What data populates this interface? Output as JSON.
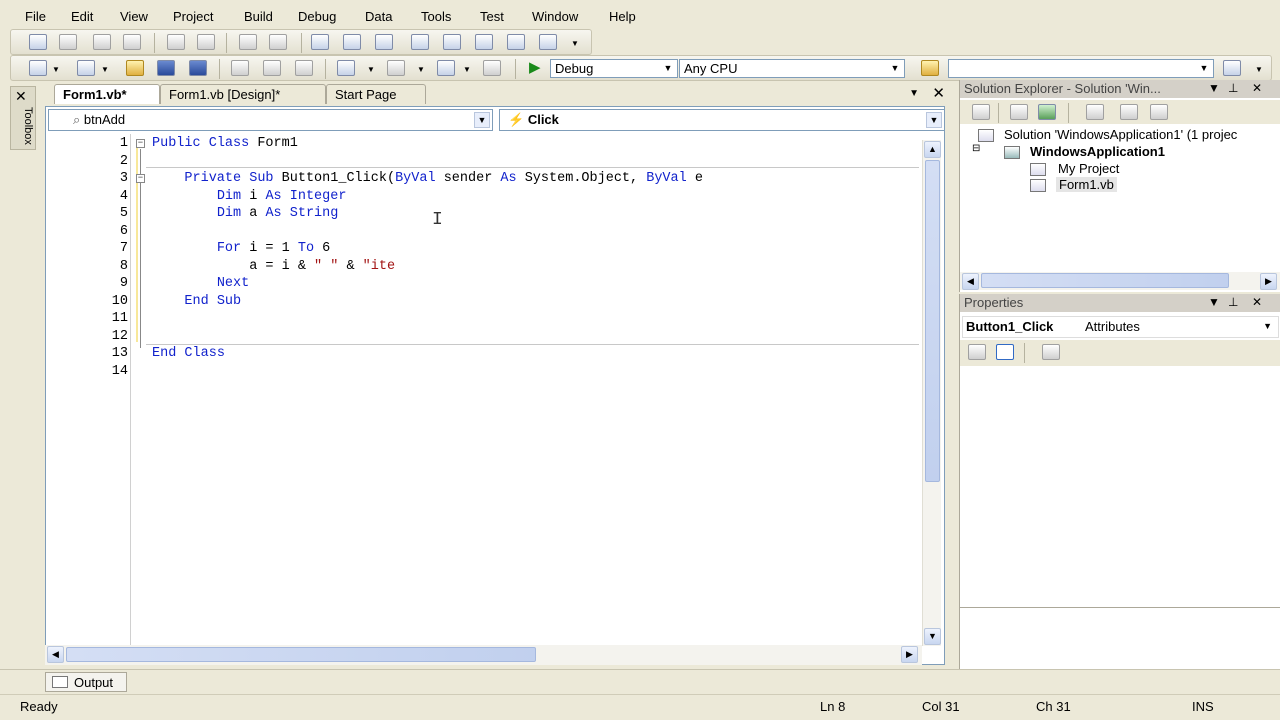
{
  "menu": [
    "File",
    "Edit",
    "View",
    "Project",
    "Build",
    "Debug",
    "Data",
    "Tools",
    "Test",
    "Window",
    "Help"
  ],
  "toolbar": {
    "config": "Debug",
    "platform": "Any CPU",
    "find_box": ""
  },
  "toolbox": {
    "label": "Toolbox"
  },
  "tabs": [
    "Form1.vb*",
    "Form1.vb [Design]*",
    "Start Page"
  ],
  "editor": {
    "class_combo": "btnAdd",
    "method_combo": "Click",
    "lines": [
      {
        "n": "1",
        "text": "Public Class Form1"
      },
      {
        "n": "2",
        "text": ""
      },
      {
        "n": "3",
        "text": "    Private Sub Button1_Click(ByVal sender As System.Object, ByVal e"
      },
      {
        "n": "4",
        "text": "        Dim i As Integer"
      },
      {
        "n": "5",
        "text": "        Dim a As String"
      },
      {
        "n": "6",
        "text": ""
      },
      {
        "n": "7",
        "text": "        For i = 1 To 6"
      },
      {
        "n": "8",
        "text": "            a = i & \" \" & \"ite"
      },
      {
        "n": "9",
        "text": "        Next"
      },
      {
        "n": "10",
        "text": "    End Sub"
      },
      {
        "n": "11",
        "text": ""
      },
      {
        "n": "12",
        "text": ""
      },
      {
        "n": "13",
        "text": "End Class"
      },
      {
        "n": "14",
        "text": ""
      }
    ]
  },
  "solution_explorer": {
    "title": "Solution Explorer - Solution 'Win...",
    "solution": "Solution 'WindowsApplication1' (1 projec",
    "project": "WindowsApplication1",
    "items": [
      "My Project",
      "Form1.vb"
    ]
  },
  "properties": {
    "title": "Properties",
    "object": "Button1_Click",
    "object_type": "Attributes"
  },
  "output_tab": "Output",
  "status": {
    "text": "Ready",
    "ln": "Ln 8",
    "col": "Col 31",
    "ch": "Ch 31",
    "mode": "INS"
  }
}
